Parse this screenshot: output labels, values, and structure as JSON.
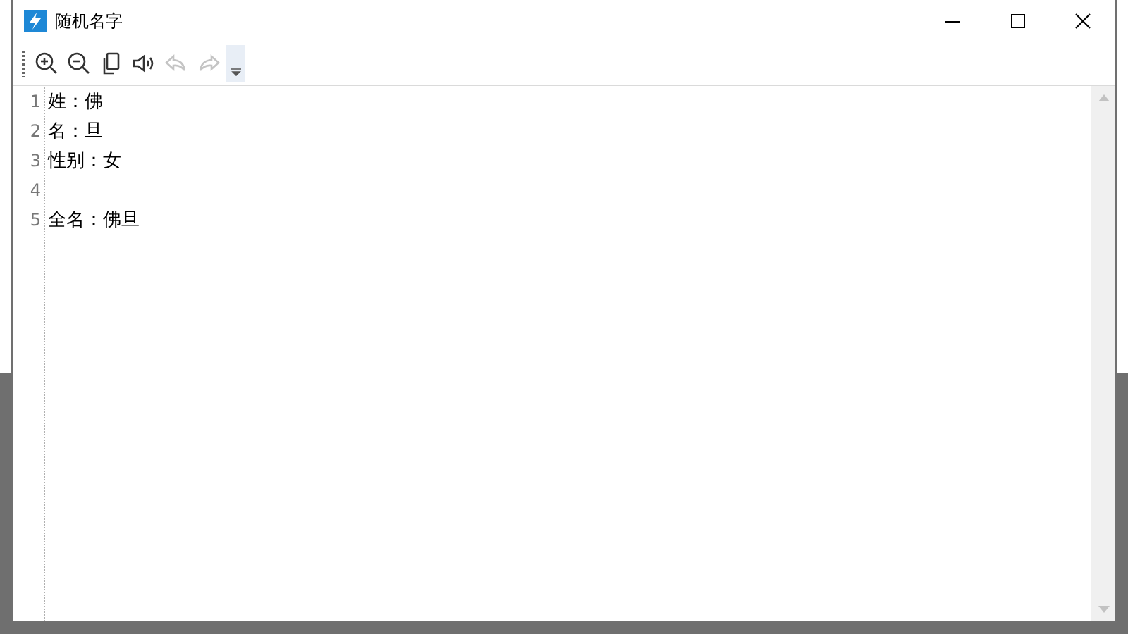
{
  "window": {
    "title": "随机名字"
  },
  "toolbar": [
    {
      "kind": "zoom-in",
      "disabled": false
    },
    {
      "kind": "zoom-out",
      "disabled": false
    },
    {
      "kind": "copy",
      "disabled": false
    },
    {
      "kind": "speak",
      "disabled": false
    },
    {
      "kind": "undo",
      "disabled": true
    },
    {
      "kind": "redo",
      "disabled": true
    },
    {
      "kind": "overflow"
    }
  ],
  "editor": {
    "lines": [
      {
        "number": "1",
        "text": "姓：佛"
      },
      {
        "number": "2",
        "text": "名：旦"
      },
      {
        "number": "3",
        "text": "性别：女"
      },
      {
        "number": "4"
      },
      {
        "number": "5",
        "text": "全名：佛旦"
      }
    ]
  }
}
